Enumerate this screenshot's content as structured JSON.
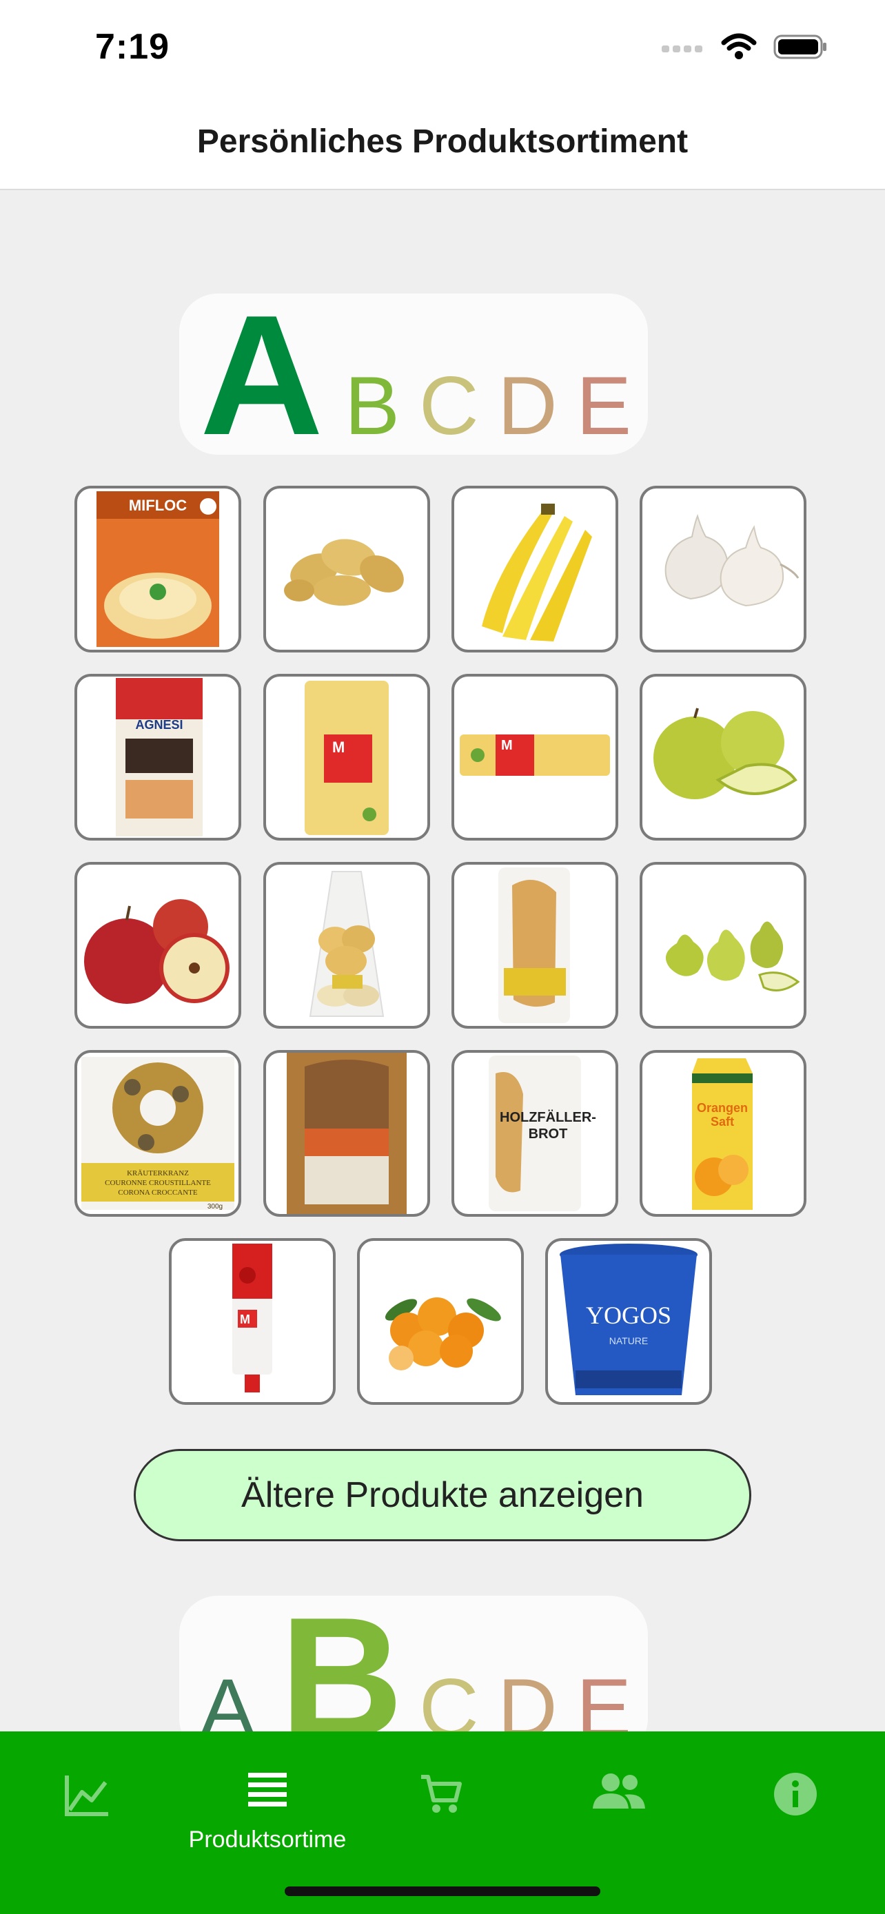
{
  "status_bar": {
    "time": "7:19"
  },
  "nav": {
    "title": "Persönliches Produktsortiment"
  },
  "grade_sections": [
    {
      "active": "A",
      "letters": [
        "A",
        "B",
        "C",
        "D",
        "E"
      ]
    },
    {
      "active": "B",
      "letters": [
        "A",
        "B",
        "C",
        "D",
        "E"
      ]
    }
  ],
  "products_grade_a": [
    {
      "name": "Mifloc Kartoffelstock",
      "icon": "product-box-icon",
      "texts": [
        "MIFLOC"
      ]
    },
    {
      "name": "Kartoffeln",
      "icon": "potatoes-icon"
    },
    {
      "name": "Bananen",
      "icon": "bananas-icon"
    },
    {
      "name": "Knoblauch",
      "icon": "garlic-icon"
    },
    {
      "name": "Agnesi Lasagne",
      "icon": "pasta-box-icon",
      "texts": [
        "AGNESI"
      ]
    },
    {
      "name": "M Schnägg Hörnli",
      "icon": "pasta-bag-icon",
      "texts": [
        "M"
      ]
    },
    {
      "name": "M Spaghettini",
      "icon": "spaghetti-pack-icon",
      "texts": [
        "M"
      ]
    },
    {
      "name": "Äpfel grün",
      "icon": "green-apples-icon"
    },
    {
      "name": "Äpfel rot",
      "icon": "red-apples-icon"
    },
    {
      "name": "Brötchen",
      "icon": "bread-rolls-icon"
    },
    {
      "name": "Baguette",
      "icon": "baguette-icon"
    },
    {
      "name": "Birnen",
      "icon": "pears-icon"
    },
    {
      "name": "Kräuterkranz",
      "icon": "bread-wreath-icon",
      "texts": [
        "KRÄUTERKRANZ",
        "COURONNE CROUSTILLANTE",
        "CORONA CROCCANTE",
        "300g"
      ]
    },
    {
      "name": "Brot",
      "icon": "bread-loaf-icon"
    },
    {
      "name": "Holzfäller-Brot",
      "icon": "bread-bag-icon",
      "texts": [
        "HOLZFÄLLER-",
        "BROT"
      ]
    },
    {
      "name": "Orangensaft",
      "icon": "juice-carton-icon",
      "texts": [
        "Orangen",
        "Saft"
      ]
    },
    {
      "name": "M Tomatenpüree",
      "icon": "tomato-tube-icon",
      "texts": [
        "M"
      ]
    },
    {
      "name": "Mandarinen",
      "icon": "mandarins-icon"
    },
    {
      "name": "Yogos Joghurt",
      "icon": "yogurt-cup-icon",
      "texts": [
        "YOGOS",
        "NATURE"
      ]
    }
  ],
  "older_button": {
    "label": "Ältere Produkte anzeigen"
  },
  "tabs": [
    {
      "id": "statistics",
      "icon": "chart-line-icon",
      "label": ""
    },
    {
      "id": "products",
      "icon": "list-icon",
      "label": "Produktsortime"
    },
    {
      "id": "cart",
      "icon": "cart-icon",
      "label": ""
    },
    {
      "id": "people",
      "icon": "people-icon",
      "label": ""
    },
    {
      "id": "info",
      "icon": "info-icon",
      "label": ""
    }
  ],
  "colors": {
    "grade_a": "#008a3e",
    "grade_b": "#80b93a",
    "grade_c": "#c9c27a",
    "grade_d": "#c9a47a",
    "grade_e": "#c98a7a",
    "tab_bar": "#06a800",
    "button_bg": "#ccffcc"
  }
}
